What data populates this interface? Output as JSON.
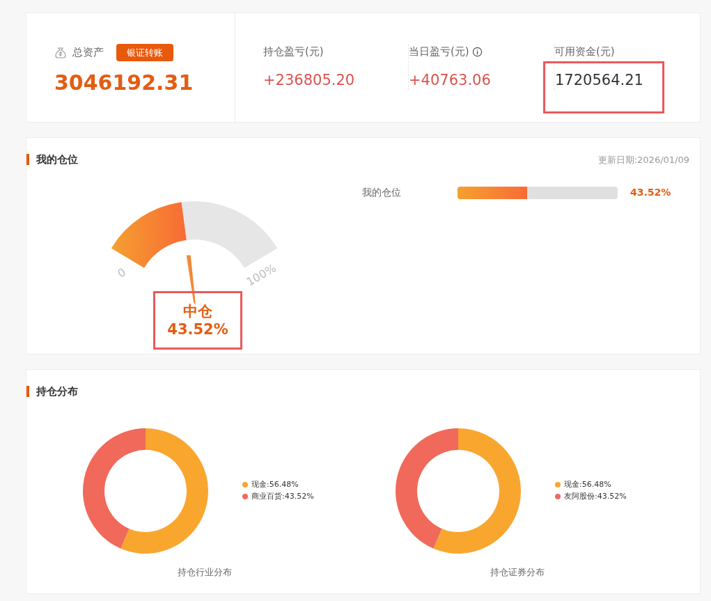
{
  "summary": {
    "total_assets": {
      "label": "总资产",
      "button": "银证转账",
      "value": "3046192.31"
    },
    "stats": [
      {
        "label": "持仓盈亏(元)",
        "value": "+236805.20",
        "kind": "gain",
        "info": false,
        "highlighted": false
      },
      {
        "label": "当日盈亏(元)",
        "value": "+40763.06",
        "kind": "gain",
        "info": true,
        "highlighted": false
      },
      {
        "label": "可用资金(元)",
        "value": "1720564.21",
        "kind": "plain",
        "info": false,
        "highlighted": true
      }
    ]
  },
  "position": {
    "title": "我的仓位",
    "updated": "更新日期:2026/01/09",
    "gauge": {
      "level": 0.4352,
      "min_label": "0",
      "max_label": "100%",
      "status": "中仓",
      "reading": "43.52%",
      "highlighted": true
    },
    "bar": {
      "label": "我的仓位",
      "level": 0.4352,
      "reading": "43.52%"
    }
  },
  "distribution": {
    "title": "持仓分布",
    "charts": [
      {
        "legend": [
          {
            "color": "#f9a62f"
          },
          {
            "color": "#f0695a"
          }
        ],
        "chart_data": {
          "type": "donut",
          "title": "持仓行业分布",
          "categories": [
            "现金:56.48%",
            "商业百货:43.52%"
          ],
          "values": [
            56.48,
            43.52
          ]
        }
      },
      {
        "legend": [
          {
            "color": "#f9a62f"
          },
          {
            "color": "#f0695a"
          }
        ],
        "chart_data": {
          "type": "donut",
          "title": "持仓证券分布",
          "categories": [
            "现金:56.48%",
            "友阿股份:43.52%"
          ],
          "values": [
            56.48,
            43.52
          ]
        }
      }
    ]
  }
}
